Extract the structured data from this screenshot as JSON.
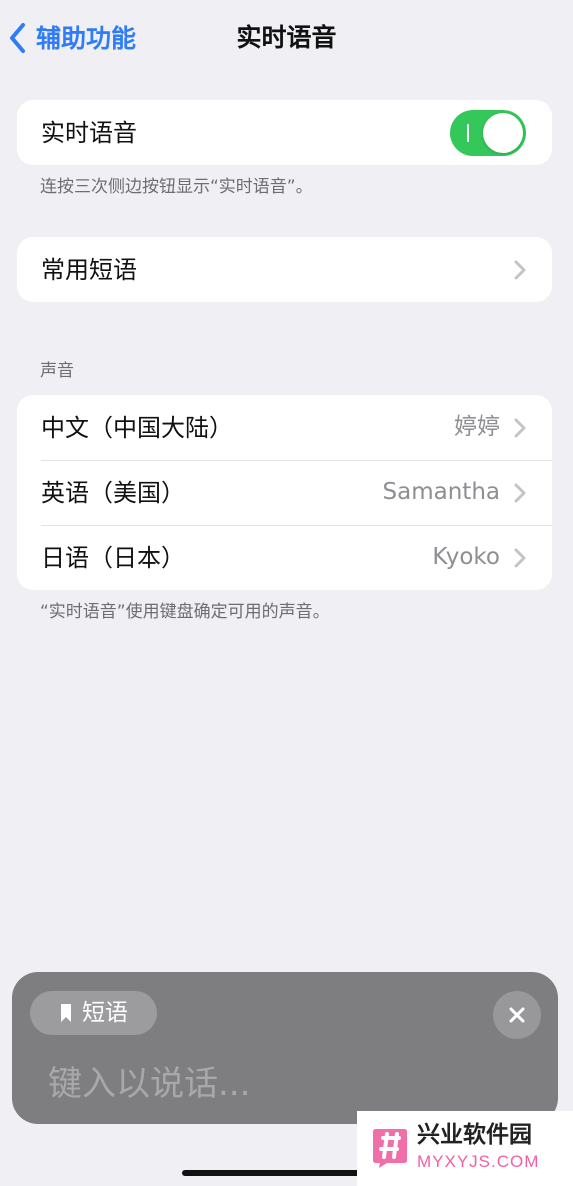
{
  "nav": {
    "back_label": "辅助功能",
    "title": "实时语音"
  },
  "live_speech": {
    "label": "实时语音",
    "enabled": true,
    "footer": "连按三次侧边按钮显示“实时语音”。"
  },
  "phrases": {
    "label": "常用短语"
  },
  "voices": {
    "header": "声音",
    "items": [
      {
        "language": "中文（中国大陆）",
        "voice": "婷婷"
      },
      {
        "language": "英语（美国）",
        "voice": "Samantha"
      },
      {
        "language": "日语（日本）",
        "voice": "Kyoko"
      }
    ],
    "footer": "“实时语音”使用键盘确定可用的声音。"
  },
  "overlay": {
    "phrases_button": "短语",
    "input_placeholder": "键入以说话..."
  },
  "watermark": {
    "title": "兴业软件园",
    "url": "MYXYJS.COM"
  },
  "colors": {
    "accent": "#2f7cf6",
    "toggle_on": "#34c759",
    "background": "#efeff4",
    "overlay": "#7e7e81",
    "watermark_url": "#f35fa5"
  },
  "icons": {
    "back": "chevron-left-icon",
    "disclosure": "chevron-right-icon",
    "phrases": "bookmark-icon",
    "close": "close-icon"
  }
}
